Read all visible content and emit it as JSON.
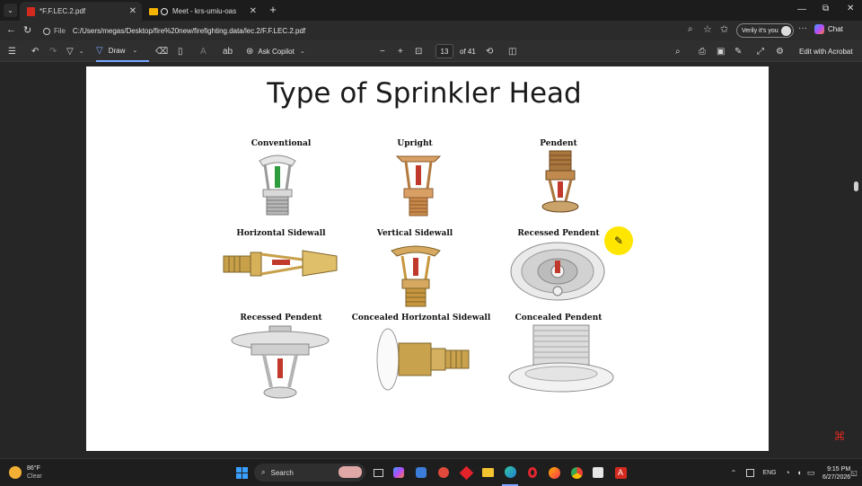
{
  "browser": {
    "tabs": [
      {
        "title": "*F.F.LEC.2.pdf"
      },
      {
        "title": "Meet - krs-umiu-oas"
      }
    ],
    "new_tab": "+",
    "address_prefix": "File",
    "address": "C:/Users/megas/Desktop/fire%20new/firefighting.data/lec.2/F.F.LEC.2.pdf",
    "profile_label": "Verily it's you",
    "chat_label": "Chat"
  },
  "pdf_toolbar": {
    "draw_label": "Draw",
    "copilot_label": "Ask Copilot",
    "page_number": "13",
    "page_total": "of 41",
    "edit_label": "Edit with Acrobat"
  },
  "slide": {
    "title": "Type of Sprinkler Head",
    "heads": [
      {
        "label": "Conventional"
      },
      {
        "label": "Upright"
      },
      {
        "label": "Pendent"
      },
      {
        "label": "Horizontal Sidewall"
      },
      {
        "label": "Vertical Sidewall"
      },
      {
        "label": "Recessed Pendent"
      },
      {
        "label": "Recessed Pendent"
      },
      {
        "label": "Concealed Horizontal Sidewall"
      },
      {
        "label": "Concealed Pendent"
      }
    ]
  },
  "taskbar": {
    "weather_temp": "86°F",
    "weather_desc": "Clear",
    "search_placeholder": "Search",
    "lang": "ENG",
    "time": "9:15 PM",
    "date": "6/27/2026"
  },
  "colors": {
    "accent": "#7aa6ff",
    "cursor_highlight": "#ffe600",
    "acrobat_red": "#d32a1f"
  }
}
